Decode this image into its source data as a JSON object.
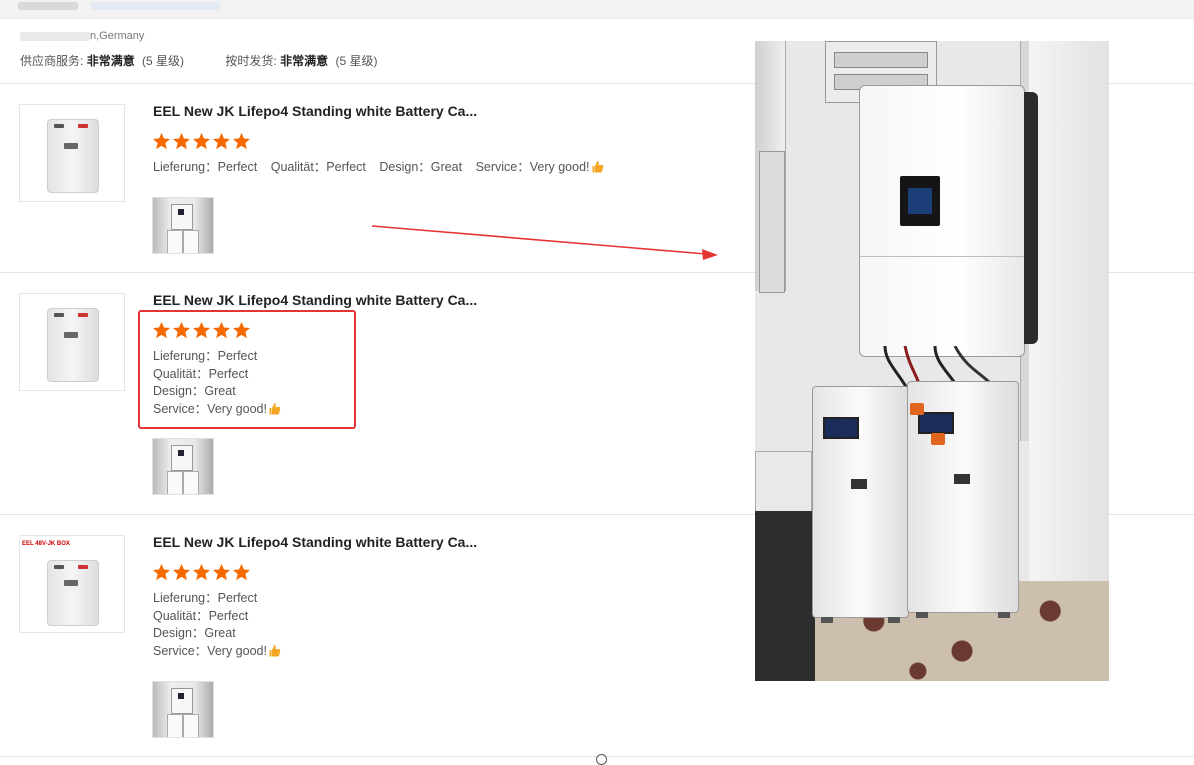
{
  "colors": {
    "star": "#f56a00",
    "highlight": "#e53333",
    "arrow": "#e53333",
    "text_primary": "#222222",
    "text_secondary": "#555555"
  },
  "header": {
    "reviewer_location": "n,Germany",
    "service_label": "供应商服务:",
    "service_value": "非常满意",
    "service_level": "(5 星级)",
    "shipping_label": "按时发货:",
    "shipping_value": "非常满意",
    "shipping_level": "(5 星级)"
  },
  "reviews": [
    {
      "title": "EEL New JK Lifepo4 Standing white Battery Ca...",
      "rating": 5,
      "lines": [
        "Lieferung:  Perfect",
        "Qualität:  Perfect",
        "Design:  Great",
        "Service:  Very good!"
      ],
      "inline_text": [
        "Lieferung：Perfect",
        "Qualität：Perfect",
        "Design：Great",
        "Service：Very good!"
      ],
      "thumb_icon": "battery-product-image",
      "emoji": "thumbs-up-icon"
    },
    {
      "title": "EEL New JK Lifepo4 Standing white Battery Ca...",
      "rating": 5,
      "lines": [
        "Lieferung：Perfect",
        "Qualität：Perfect",
        "Design：Great",
        "Service：Very good!"
      ],
      "thumb_icon": "battery-product-image",
      "emoji": "thumbs-up-icon"
    },
    {
      "title": "EEL New JK Lifepo4 Standing white Battery Ca...",
      "rating": 5,
      "lines": [
        "Lieferung：Perfect",
        "Qualität：Perfect",
        "Design：Great",
        "Service：Very good!"
      ],
      "thumb_icon": "battery-product-image",
      "banner_text": "EEL 48V-JK BOX",
      "emoji": "thumbs-up-icon"
    }
  ],
  "photo": {
    "subject": "inverter-and-two-battery-cabinets-photo"
  }
}
